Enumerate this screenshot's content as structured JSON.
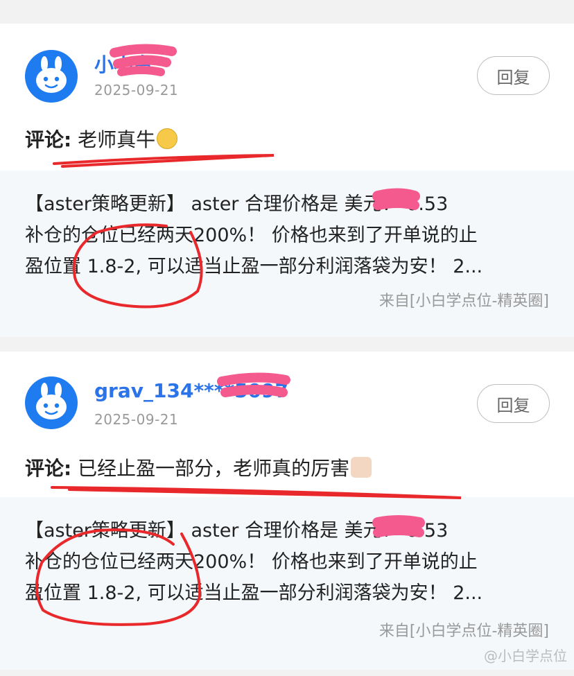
{
  "reply_label": "回复",
  "comment_label": "评论:",
  "comments": [
    {
      "username": "小小白",
      "date": "2025-09-21",
      "text": "老师真牛",
      "emoji": "grinning-face",
      "quote_lines": [
        "【aster策略更新】 aster 合理价格是    美元！ 0.53",
        "补仓的仓位已经两天200%！ 价格也来到了开单说的止",
        "盈位置 1.8-2, 可以适当止盈一部分利润落袋为安！ 2..."
      ],
      "source": "来自[小白学点位-精英圈]"
    },
    {
      "username": "grav_134****5097",
      "date": "2025-09-21",
      "text": "已经止盈一部分，老师真的厉害",
      "emoji": "thumbs-up",
      "quote_lines": [
        "【aster策略更新】 aster 合理价格是    美元！ 0.53",
        "补仓的仓位已经两天200%！ 价格也来到了开单说的止",
        "盈位置 1.8-2, 可以适当止盈一部分利润落袋为安！ 2..."
      ],
      "source": "来自[小白学点位-精英圈]"
    }
  ],
  "watermark": "@小白学点位",
  "colors": {
    "accent_blue": "#2a73e8",
    "avatar_blue": "#1e7cf0",
    "annotation_red": "#e8282b",
    "redaction_pink": "#f45a8e"
  }
}
